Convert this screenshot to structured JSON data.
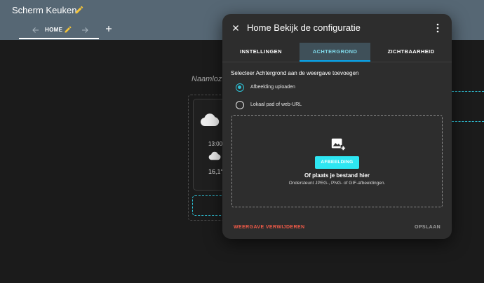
{
  "app": {
    "title": "Scherm Keuken"
  },
  "view_tabs": {
    "home_label": "HOME"
  },
  "background_view": {
    "title": "Naamloz",
    "card": {
      "time": "13:00",
      "temperature": "16,1°"
    }
  },
  "dialog": {
    "title": "Home Bekijk de configuratie",
    "tabs": [
      {
        "label": "INSTELLINGEN",
        "active": false
      },
      {
        "label": "ACHTERGROND",
        "active": true
      },
      {
        "label": "ZICHTBAARHEID",
        "active": false
      }
    ],
    "section_label": "Selecteer Achtergrond aan de weergave toevoegen",
    "options": [
      {
        "label": "Afbeelding uploaden",
        "checked": true
      },
      {
        "label": "Lokaal pad of web-URL",
        "checked": false
      }
    ],
    "dropzone": {
      "button_label": "AFBEELDING",
      "text": "Of plaats je bestand hier",
      "hint": "Ondersteunt JPEG-, PNG- of GIF-afbeeldingen."
    },
    "footer": {
      "delete_label": "WEERGAVE VERWIJDEREN",
      "save_label": "OPSLAAN"
    }
  },
  "colors": {
    "toolbar": "#566774",
    "accent": "#2ec1d6",
    "upload_button": "#2ee6f2",
    "edit_icon": "#f2c23a",
    "danger": "#ef5a48"
  },
  "icons": [
    "pencil-icon",
    "arrow-left-icon",
    "arrow-right-icon",
    "plus-icon",
    "cloud-icon",
    "close-icon",
    "more-vertical-icon",
    "image-plus-icon"
  ]
}
